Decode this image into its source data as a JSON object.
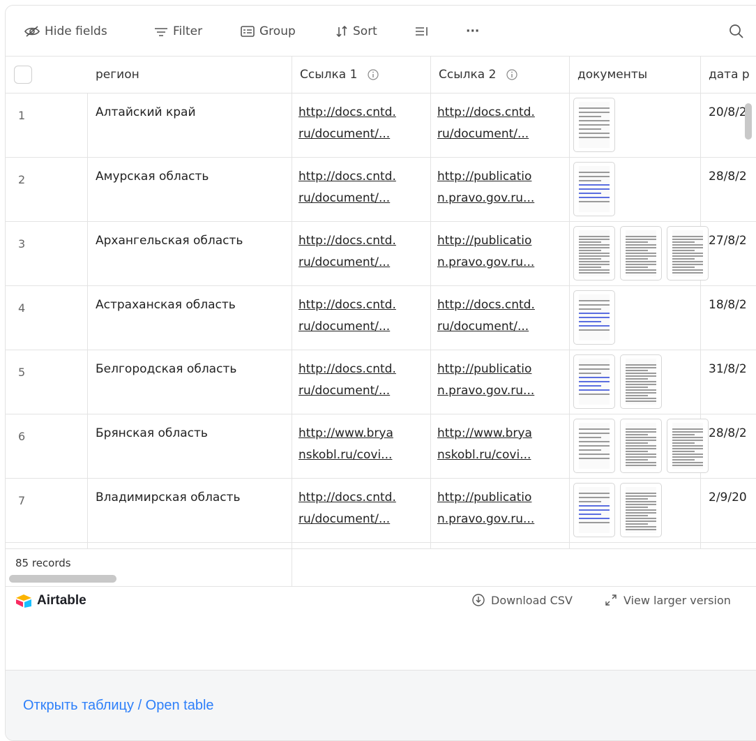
{
  "toolbar": {
    "hide_fields": "Hide fields",
    "filter": "Filter",
    "group": "Group",
    "sort": "Sort",
    "more": "···"
  },
  "columns": {
    "region": "регион",
    "link1": "Ссылка 1",
    "link2": "Ссылка 2",
    "docs": "документы",
    "date": "дата р"
  },
  "rows": [
    {
      "num": "1",
      "region": "Алтайский край",
      "link1": [
        "http://docs.cntd.",
        "ru/document/..."
      ],
      "link2": [
        "http://docs.cntd.",
        "ru/document/..."
      ],
      "date": "20/8/2"
    },
    {
      "num": "2",
      "region": "Амурская область",
      "link1": [
        "http://docs.cntd.",
        "ru/document/..."
      ],
      "link2": [
        "http://publicatio",
        "n.pravo.gov.ru..."
      ],
      "date": "28/8/2"
    },
    {
      "num": "3",
      "region": "Архангельская область",
      "link1": [
        "http://docs.cntd.",
        "ru/document/..."
      ],
      "link2": [
        "http://publicatio",
        "n.pravo.gov.ru..."
      ],
      "date": "27/8/2"
    },
    {
      "num": "4",
      "region": "Астраханская область",
      "link1": [
        "http://docs.cntd.",
        "ru/document/..."
      ],
      "link2": [
        "http://docs.cntd.",
        "ru/document/..."
      ],
      "date": "18/8/2"
    },
    {
      "num": "5",
      "region": "Белгородская область",
      "link1": [
        "http://docs.cntd.",
        "ru/document/..."
      ],
      "link2": [
        "http://publicatio",
        "n.pravo.gov.ru..."
      ],
      "date": "31/8/2"
    },
    {
      "num": "6",
      "region": "Брянская область",
      "link1": [
        "http://www.brya",
        "nskobl.ru/covi..."
      ],
      "link2": [
        "http://www.brya",
        "nskobl.ru/covi..."
      ],
      "date": "28/8/2"
    },
    {
      "num": "7",
      "region": "Владимирская область",
      "link1": [
        "http://docs.cntd.",
        "ru/document/..."
      ],
      "link2": [
        "http://publicatio",
        "n.pravo.gov.ru..."
      ],
      "date": "2/9/20"
    }
  ],
  "footer": {
    "records": "85 records",
    "brand": "Airtable",
    "download": "Download CSV",
    "view_larger": "View larger version"
  },
  "open_table": "Открыть таблицу / Open table",
  "colors": {
    "accent": "#2d7ff9",
    "border": "#e3e3e3"
  }
}
